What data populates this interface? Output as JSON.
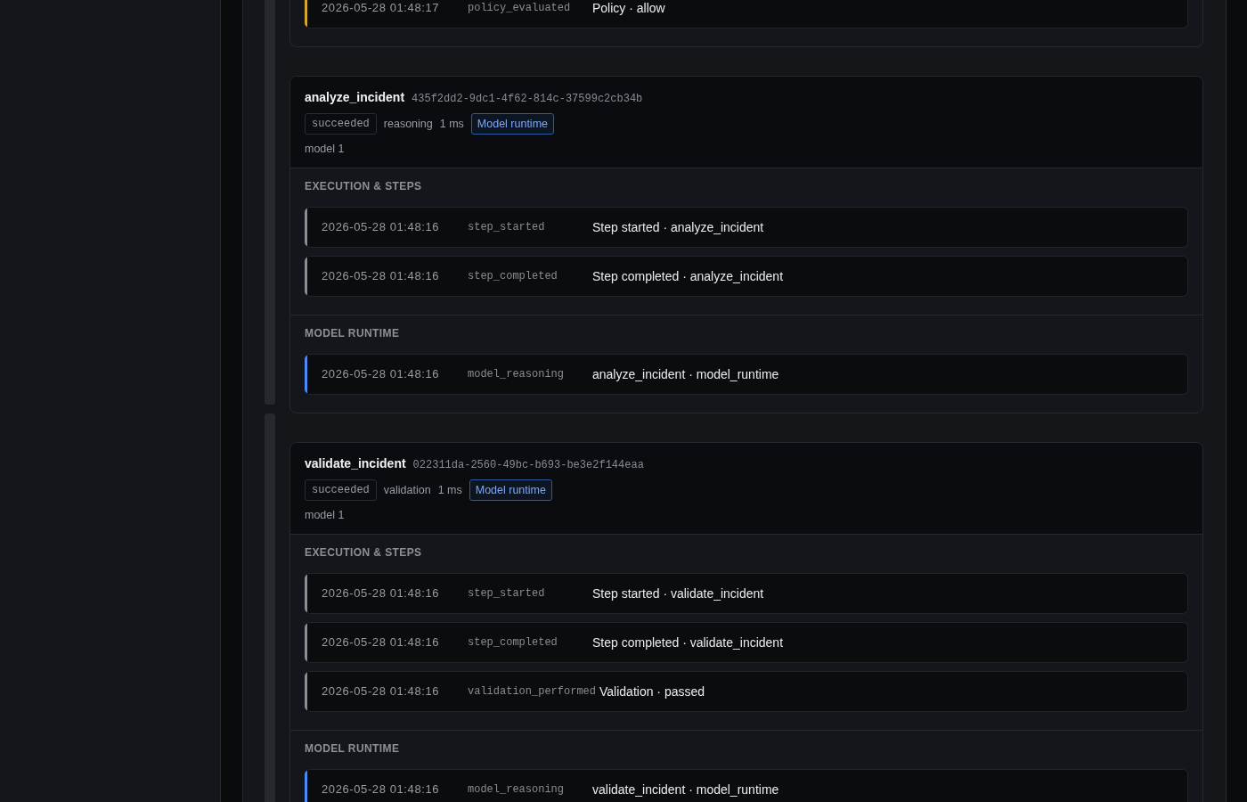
{
  "steps": [
    {
      "sections": [
        {
          "events": [
            {
              "time": "2026-05-28 01:48:17",
              "type": "policy_evaluated",
              "message": "Policy · allow",
              "color": "#d4a72c"
            }
          ]
        }
      ]
    },
    {
      "name": "analyze_incident",
      "id": "435f2dd2-9dc1-4f62-814c-37599c2cb34b",
      "status": "succeeded",
      "step_kind": "reasoning",
      "duration": "1 ms",
      "tag": "Model runtime",
      "model": "model 1",
      "sections": [
        {
          "title": "EXECUTION & STEPS",
          "events": [
            {
              "time": "2026-05-28 01:48:16",
              "type": "step_started",
              "message": "Step started · analyze_incident",
              "color": "#8b8d93"
            },
            {
              "time": "2026-05-28 01:48:16",
              "type": "step_completed",
              "message": "Step completed · analyze_incident",
              "color": "#8b8d93"
            }
          ]
        },
        {
          "title": "MODEL RUNTIME",
          "events": [
            {
              "time": "2026-05-28 01:48:16",
              "type": "model_reasoning",
              "message": "analyze_incident · model_runtime",
              "color": "#4c8bf5"
            }
          ]
        }
      ]
    },
    {
      "name": "validate_incident",
      "id": "022311da-2560-49bc-b693-be3e2f144eaa",
      "status": "succeeded",
      "step_kind": "validation",
      "duration": "1 ms",
      "tag": "Model runtime",
      "model": "model 1",
      "sections": [
        {
          "title": "EXECUTION & STEPS",
          "events": [
            {
              "time": "2026-05-28 01:48:16",
              "type": "step_started",
              "message": "Step started · validate_incident",
              "color": "#8b8d93"
            },
            {
              "time": "2026-05-28 01:48:16",
              "type": "step_completed",
              "message": "Step completed · validate_incident",
              "color": "#8b8d93"
            },
            {
              "time": "2026-05-28 01:48:16",
              "type": "validation_performed",
              "message": "Validation · passed",
              "color": "#8b8d93"
            }
          ]
        },
        {
          "title": "MODEL RUNTIME",
          "events": [
            {
              "time": "2026-05-28 01:48:16",
              "type": "model_reasoning",
              "message": "validate_incident · model_runtime",
              "color": "#4c8bf5"
            }
          ]
        }
      ]
    }
  ]
}
